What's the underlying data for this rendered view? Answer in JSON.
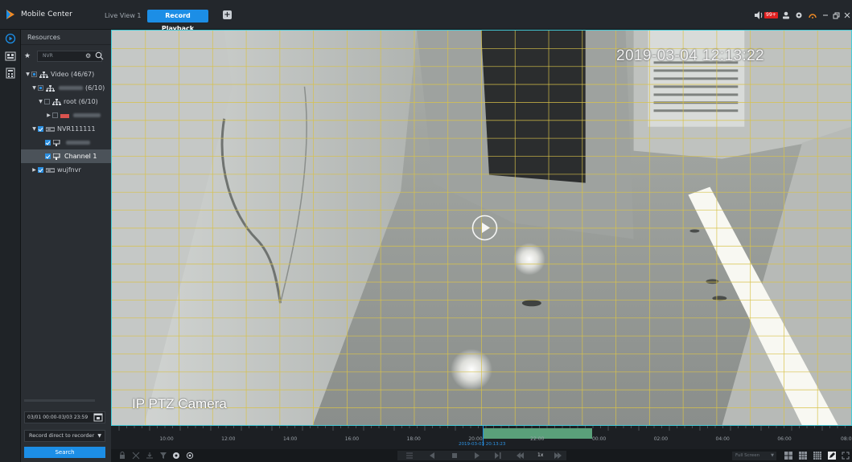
{
  "titlebar": {
    "app_title": "Mobile Center",
    "tabs": [
      {
        "label": "Live View 1",
        "active": false
      },
      {
        "label": "Record Playback",
        "active": true
      }
    ],
    "notification_count": "99+",
    "accent_color": "#1c8ee6"
  },
  "left_panel": {
    "resources_label": "Resources",
    "search": {
      "value": "NVR"
    },
    "tree": [
      {
        "label": "Video (46/67)",
        "level": 0,
        "expanded": true
      },
      {
        "label": "(6/10)",
        "level": 1,
        "expanded": true
      },
      {
        "label": "root (6/10)",
        "level": 2,
        "expanded": true
      },
      {
        "label": "",
        "level": 3,
        "expanded": false
      },
      {
        "label": "NVR111111",
        "level": 1,
        "expanded": true
      },
      {
        "label": "",
        "level": 2
      },
      {
        "label": "Channel 1",
        "level": 2,
        "selected": true
      },
      {
        "label": "wujfnvr",
        "level": 1,
        "expanded": false
      }
    ],
    "date_range": "03/01 00:00-03/03 23:59",
    "record_source": "Record direct to recorder",
    "search_button": "Search"
  },
  "video": {
    "osd_time": "2019-03-04 12:13:22",
    "osd_camera": "IP PTZ Camera"
  },
  "timeline": {
    "labels": [
      "10:00",
      "12:00",
      "14:00",
      "16:00",
      "18:00",
      "20:00",
      "22:00",
      "00:00",
      "02:00",
      "04:00",
      "06:00",
      "08:0"
    ],
    "current_time": "2019-03-03 20:13:23",
    "record_color": "#5aa07a"
  },
  "bottombar": {
    "speed": "1x",
    "view_mode": "Full Screen"
  }
}
